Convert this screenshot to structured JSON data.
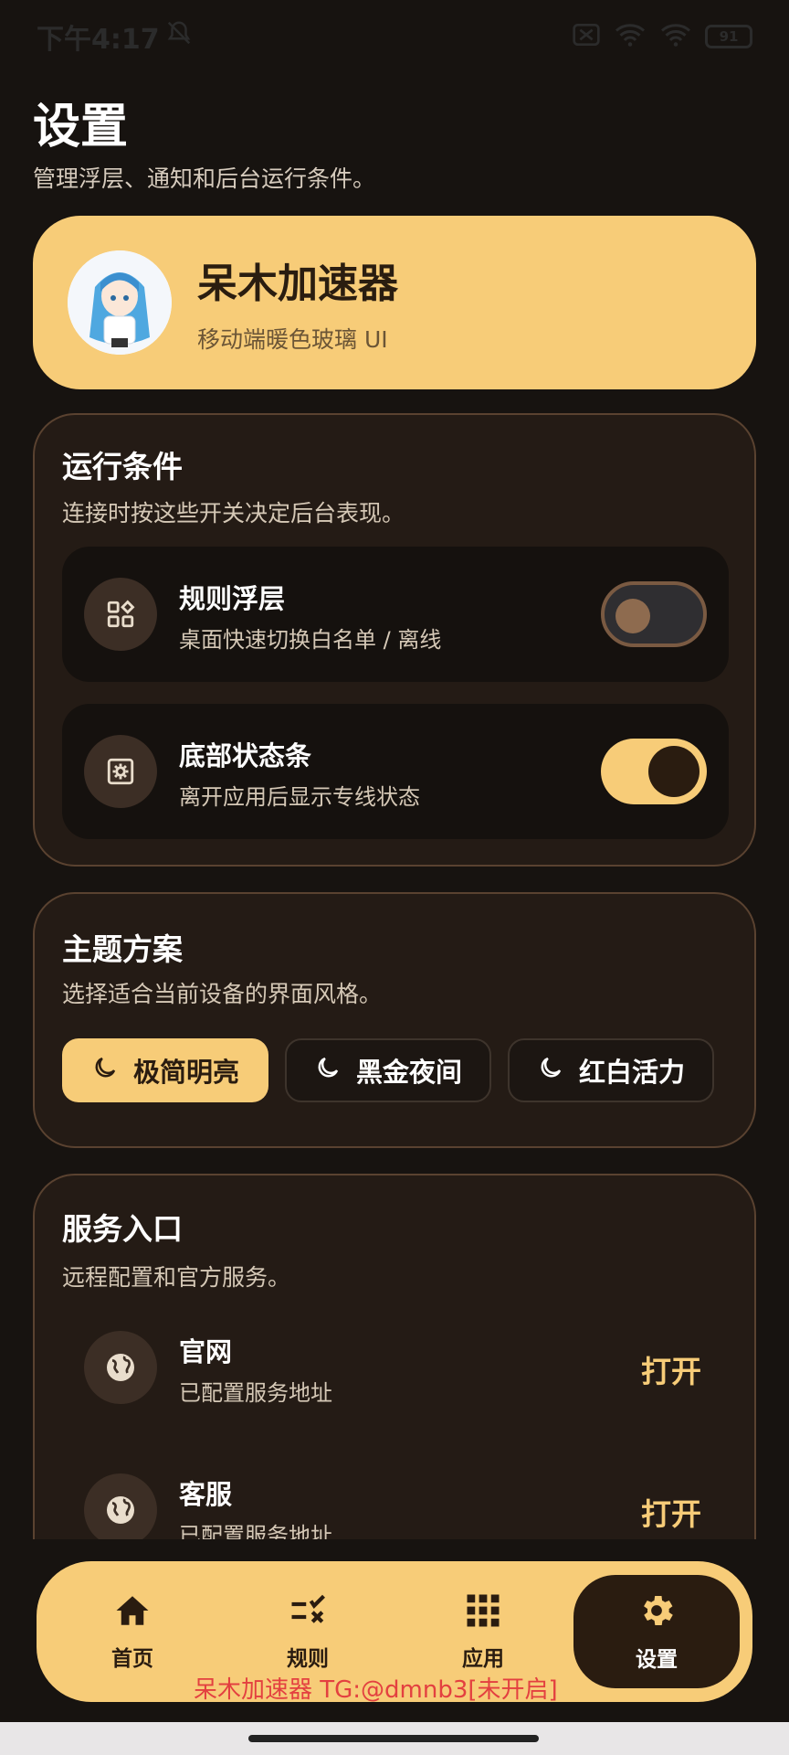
{
  "status_bar": {
    "time": "下午4:17",
    "battery": "91"
  },
  "page": {
    "title": "设置",
    "subtitle": "管理浮层、通知和后台运行条件。"
  },
  "profile": {
    "name": "呆木加速器",
    "desc": "移动端暖色玻璃 UI"
  },
  "run_conditions": {
    "title": "运行条件",
    "subtitle": "连接时按这些开关决定后台表现。",
    "items": [
      {
        "title": "规则浮层",
        "desc": "桌面快速切换白名单 / 离线",
        "enabled": false
      },
      {
        "title": "底部状态条",
        "desc": "离开应用后显示专线状态",
        "enabled": true
      }
    ]
  },
  "theme": {
    "title": "主题方案",
    "subtitle": "选择适合当前设备的界面风格。",
    "options": [
      "极简明亮",
      "黑金夜间",
      "红白活力"
    ],
    "selected": "极简明亮"
  },
  "services": {
    "title": "服务入口",
    "subtitle": "远程配置和官方服务。",
    "items": [
      {
        "title": "官网",
        "desc": "已配置服务地址",
        "action": "打开"
      },
      {
        "title": "客服",
        "desc": "已配置服务地址",
        "action": "打开"
      }
    ]
  },
  "nav": {
    "items": [
      "首页",
      "规则",
      "应用",
      "设置"
    ],
    "active": "设置"
  },
  "watermark": "呆木加速器 TG:@dmnb3[未开启]",
  "colors": {
    "accent": "#f7cc78",
    "background": "#171310",
    "card": "#241b15"
  }
}
